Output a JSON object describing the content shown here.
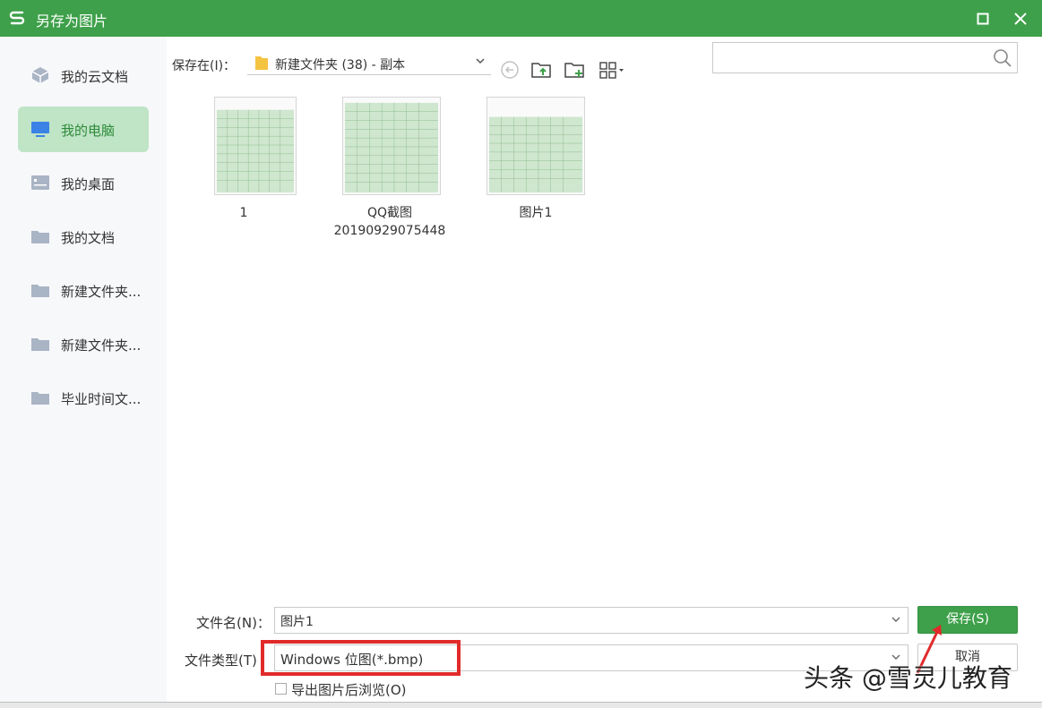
{
  "window": {
    "title": "另存为图片",
    "accent": "#3ea04a"
  },
  "sidebar": {
    "items": [
      {
        "label": "我的云文档",
        "icon": "cloud-doc-icon",
        "active": false
      },
      {
        "label": "我的电脑",
        "icon": "computer-icon",
        "active": true
      },
      {
        "label": "我的桌面",
        "icon": "desktop-icon",
        "active": false
      },
      {
        "label": "我的文档",
        "icon": "folder-icon",
        "active": false
      },
      {
        "label": "新建文件夹...",
        "icon": "folder-icon",
        "active": false
      },
      {
        "label": "新建文件夹...",
        "icon": "folder-icon",
        "active": false
      },
      {
        "label": "毕业时间文...",
        "icon": "folder-icon",
        "active": false
      }
    ]
  },
  "toolbar": {
    "save_in_label": "保存在(I)：",
    "path": "新建文件夹 (38) - 副本",
    "search_placeholder": ""
  },
  "files": [
    {
      "name": "1"
    },
    {
      "name": "QQ截图\n20190929075448"
    },
    {
      "name": "图片1"
    }
  ],
  "form": {
    "filename_label": "文件名(N)：",
    "filename_value": "图片1",
    "filetype_label": "文件类型(T)",
    "filetype_value": "Windows 位图(*.bmp)",
    "save_button": "保存(S)",
    "cancel_button": "取消",
    "preview_checkbox_label": "导出图片后浏览(O)"
  },
  "watermark": "头条 @雪灵儿教育",
  "colors": {
    "highlight": "#e12a2a",
    "active_bg": "#bfe4c6"
  }
}
